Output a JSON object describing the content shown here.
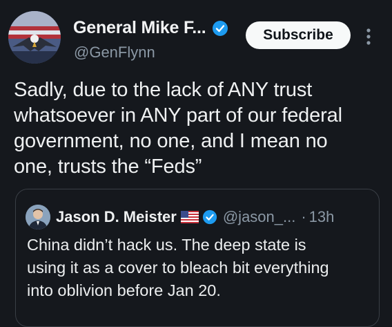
{
  "author": {
    "display_name": "General Mike F...",
    "handle": "@GenFlynn",
    "avatar_icon": "eagle-flag-avatar",
    "verified_color": "#1d9bf0"
  },
  "actions": {
    "subscribe_label": "Subscribe",
    "more_icon": "more-vertical-icon"
  },
  "tweet": {
    "lines": [
      "Sadly, due to the lack of ANY trust",
      "whatsoever in ANY part of our federal",
      "government, no one, and I mean no",
      "one, trusts the “Feds”"
    ]
  },
  "quote": {
    "display_name": "Jason D. Meister",
    "flag_icon": "us-flag-icon",
    "handle": "@jason_...",
    "separator": "·",
    "time": "13h",
    "lines": [
      "China didn’t hack us. The deep state is",
      "using it as a cover to bleach bit everything",
      "into oblivion before Jan 20."
    ]
  },
  "colors": {
    "background": "#15181d",
    "text": "#e7e9ea",
    "secondary_text": "#8b98a5",
    "button_bg": "#f7f9f9",
    "border": "#3a3f46"
  }
}
